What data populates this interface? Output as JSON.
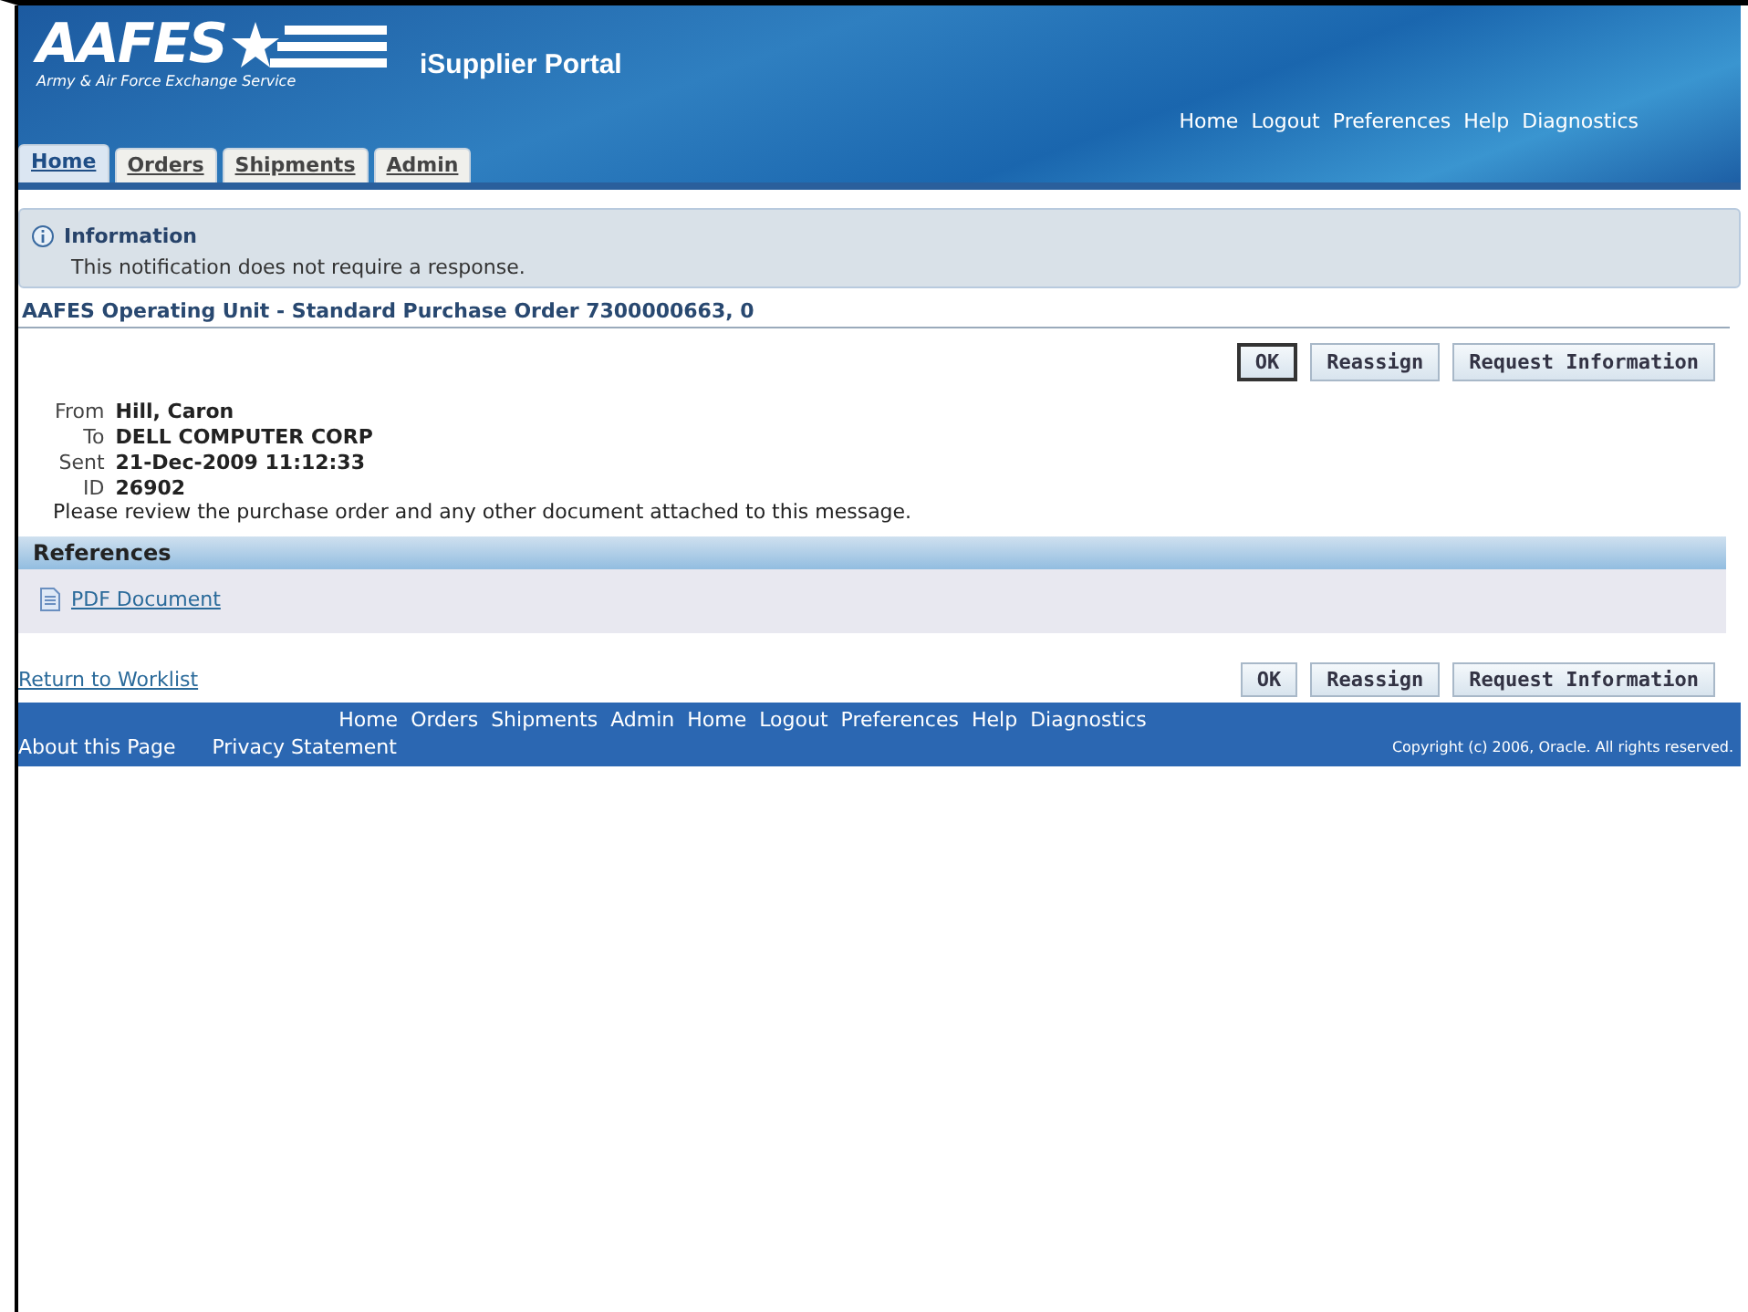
{
  "header": {
    "logo_text": "AAFES",
    "logo_subtitle": "Army & Air Force Exchange Service",
    "app_title": "iSupplier Portal",
    "global_links": [
      "Home",
      "Logout",
      "Preferences",
      "Help",
      "Diagnostics"
    ]
  },
  "tabs": [
    {
      "label": "Home",
      "selected": true
    },
    {
      "label": "Orders",
      "selected": false
    },
    {
      "label": "Shipments",
      "selected": false
    },
    {
      "label": "Admin",
      "selected": false
    }
  ],
  "info_box": {
    "title": "Information",
    "message": "This notification does not require a response."
  },
  "page_title": "AAFES Operating Unit - Standard Purchase Order 7300000663, 0",
  "buttons_top": [
    {
      "label": "OK",
      "selected": true
    },
    {
      "label": "Reassign",
      "selected": false
    },
    {
      "label": "Request Information",
      "selected": false
    }
  ],
  "fields": [
    {
      "label": "From",
      "value": "Hill, Caron"
    },
    {
      "label": "To",
      "value": "DELL COMPUTER CORP"
    },
    {
      "label": "Sent",
      "value": "21-Dec-2009 11:12:33"
    },
    {
      "label": "ID",
      "value": "26902"
    }
  ],
  "instruction": "Please review the purchase order and any other document attached to this message.",
  "references": {
    "title": "References",
    "links": [
      "PDF Document"
    ]
  },
  "return_link": "Return to Worklist",
  "buttons_bottom": [
    {
      "label": "OK",
      "selected": false
    },
    {
      "label": "Reassign",
      "selected": false
    },
    {
      "label": "Request Information",
      "selected": false
    }
  ],
  "footer": {
    "links": [
      "Home",
      "Orders",
      "Shipments",
      "Admin",
      "Home",
      "Logout",
      "Preferences",
      "Help",
      "Diagnostics"
    ],
    "bottom_links": [
      "About this Page",
      "Privacy Statement"
    ],
    "copyright": "Copyright (c) 2006, Oracle. All rights reserved."
  }
}
